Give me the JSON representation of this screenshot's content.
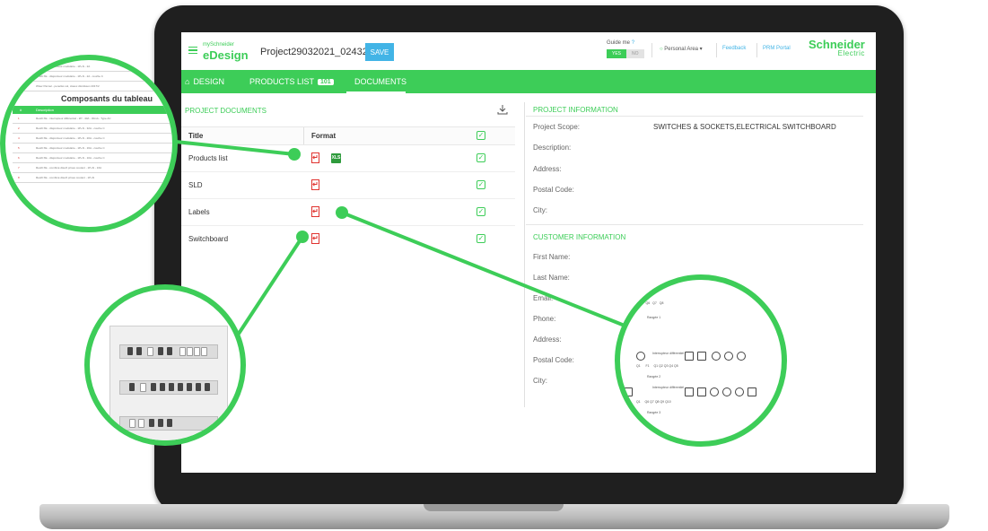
{
  "header": {
    "brand_small": "mySchneider",
    "brand_name": "eDesign",
    "project_name": "Project29032021_024328",
    "save_label": "SAVE",
    "guide_label": "Guide me",
    "guide_yes": "YES",
    "guide_no": "NO",
    "personal_area": "Personal Area",
    "feedback": "Feedback",
    "prm_portal": "PRM Portal",
    "logo_line1": "Schneider",
    "logo_line2": "Electric",
    "accent_color": "#3dcd58",
    "button_color": "#42b4e6"
  },
  "nav": {
    "design": "DESIGN",
    "products_list": "PRODUCTS LIST",
    "products_count": "101",
    "documents": "DOCUMENTS",
    "active": "DOCUMENTS"
  },
  "documents": {
    "section_title": "PROJECT DOCUMENTS",
    "col_title": "Title",
    "col_format": "Format",
    "rows": [
      {
        "title": "Products list",
        "formats": [
          "pdf",
          "xls"
        ],
        "checked": true
      },
      {
        "title": "SLD",
        "formats": [
          "pdf"
        ],
        "checked": true
      },
      {
        "title": "Labels",
        "formats": [
          "pdf"
        ],
        "checked": true
      },
      {
        "title": "Switchboard",
        "formats": [
          "pdf"
        ],
        "checked": true
      }
    ]
  },
  "project_info": {
    "section_title": "PROJECT INFORMATION",
    "scope_label": "Project Scope:",
    "scope_value": "SWITCHES & SOCKETS,ELECTRICAL SWITCHBOARD",
    "description_label": "Description:",
    "address_label": "Address:",
    "postal_label": "Postal Code:",
    "city_label": "City:"
  },
  "customer_info": {
    "section_title": "CUSTOMER INFORMATION",
    "first_name_label": "First Name:",
    "last_name_label": "Last Name:",
    "email_label": "Email:",
    "phone_label": "Phone:",
    "address_label": "Address:",
    "postal_label": "Postal Code:",
    "city_label": "City:"
  },
  "callouts": {
    "products_preview_title": "Composants du tableau",
    "products_preview_col": "Description"
  }
}
